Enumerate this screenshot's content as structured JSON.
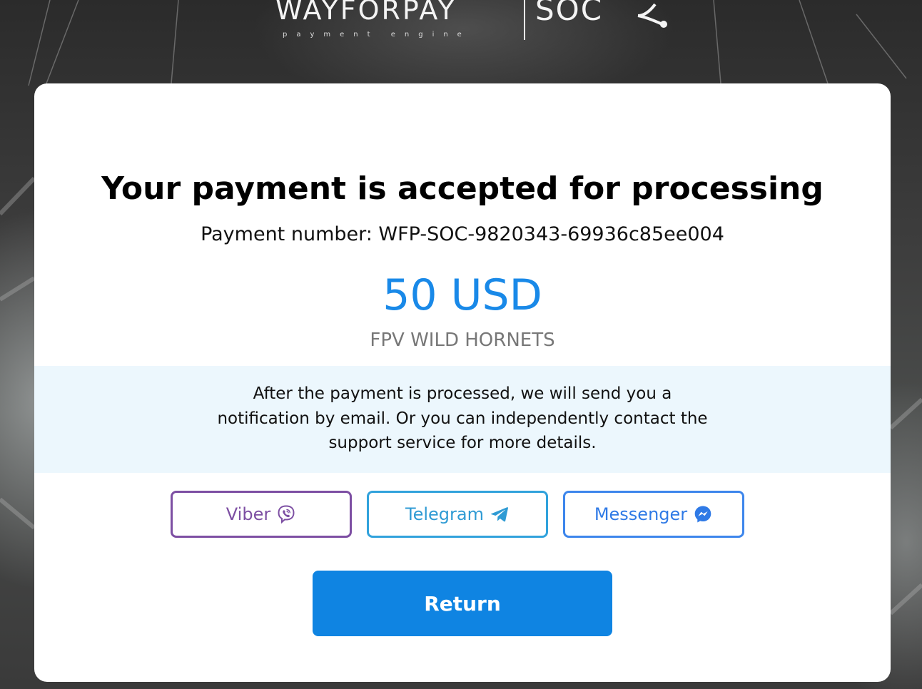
{
  "logo": {
    "brand": "WAYFORPAY",
    "tagline": "payment engine",
    "partner": "SOC"
  },
  "result": {
    "title": "Your payment is accepted for processing",
    "payment_number": "Payment number: WFP-SOC-9820343-69936c85ee004",
    "amount": "50 USD",
    "merchant": "FPV WILD HORNETS"
  },
  "notice": {
    "text": "After the payment is processed, we will send you a notification by email. Or you can independently contact the support service for more details."
  },
  "support": {
    "buttons": [
      {
        "label": "Viber",
        "icon": "viber-icon",
        "color": "#7d4fa3"
      },
      {
        "label": "Telegram",
        "icon": "telegram-icon",
        "color": "#31a2dc"
      },
      {
        "label": "Messenger",
        "icon": "messenger-icon",
        "color": "#3d86ec"
      }
    ]
  },
  "actions": {
    "return_label": "Return"
  },
  "colors": {
    "accent": "#1989e8",
    "button": "#0f84e2",
    "notice_bg": "#ecf7fd"
  }
}
